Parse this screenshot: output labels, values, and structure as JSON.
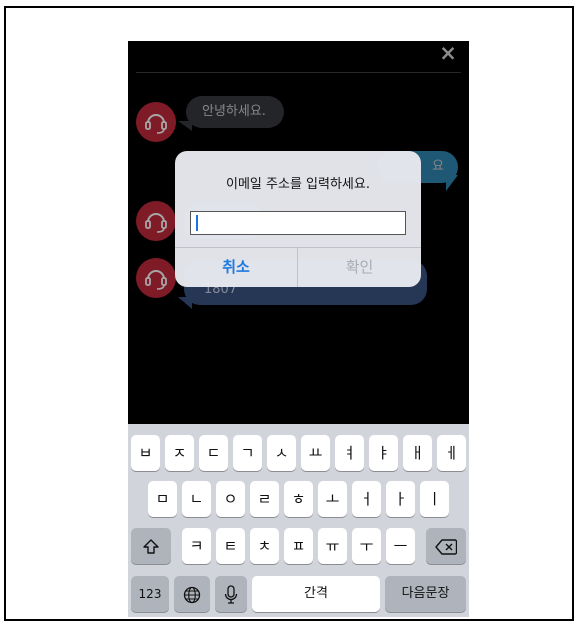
{
  "header": {
    "close_icon": "×"
  },
  "chat": {
    "messages": [
      {
        "text": "안녕하세요."
      },
      {
        "text": "요"
      },
      {
        "text": ""
      },
      {
        "text": "1807"
      }
    ]
  },
  "dialog": {
    "title": "이메일 주소를 입력하세요.",
    "input_value": "",
    "cancel_label": "취소",
    "confirm_label": "확인"
  },
  "keyboard": {
    "row1": [
      "ㅂ",
      "ㅈ",
      "ㄷ",
      "ㄱ",
      "ㅅ",
      "ㅛ",
      "ㅕ",
      "ㅑ",
      "ㅐ",
      "ㅔ"
    ],
    "row2": [
      "ㅁ",
      "ㄴ",
      "ㅇ",
      "ㄹ",
      "ㅎ",
      "ㅗ",
      "ㅓ",
      "ㅏ",
      "ㅣ"
    ],
    "row3": [
      "ㅋ",
      "ㅌ",
      "ㅊ",
      "ㅍ",
      "ㅠ",
      "ㅜ",
      "ㅡ"
    ],
    "numbers_label": "123",
    "space_label": "간격",
    "return_label": "다음문장"
  },
  "colors": {
    "avatar": "#c42a3c",
    "accent": "#1f7ae0"
  }
}
